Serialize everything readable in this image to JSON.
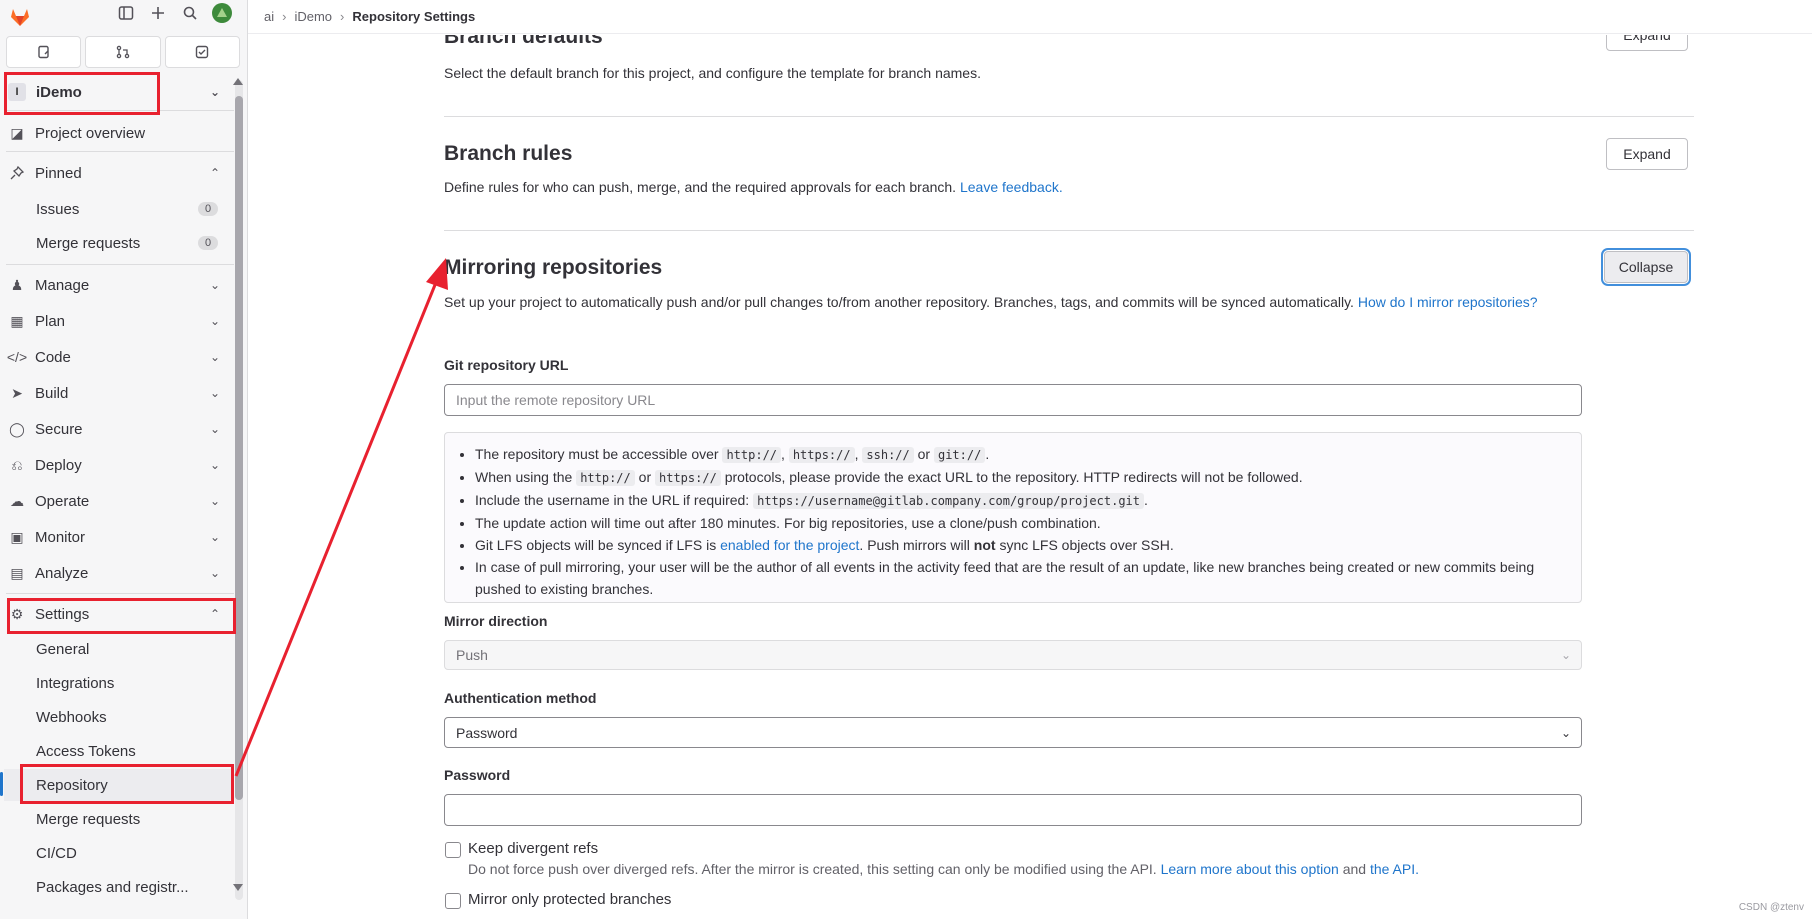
{
  "sidebar": {
    "project_initial": "I",
    "project_name": "iDemo",
    "project_overview": "Project overview",
    "pinned": "Pinned",
    "pinned_items": [
      {
        "label": "Issues",
        "count": "0"
      },
      {
        "label": "Merge requests",
        "count": "0"
      }
    ],
    "groups": [
      "Manage",
      "Plan",
      "Code",
      "Build",
      "Secure",
      "Deploy",
      "Operate",
      "Monitor",
      "Analyze"
    ],
    "settings": "Settings",
    "settings_items": [
      "General",
      "Integrations",
      "Webhooks",
      "Access Tokens",
      "Repository",
      "Merge requests",
      "CI/CD",
      "Packages and registr..."
    ],
    "active_item": "Repository"
  },
  "breadcrumb": {
    "group": "ai",
    "project": "iDemo",
    "current": "Repository Settings"
  },
  "sections": {
    "branch_defaults": {
      "title": "Branch defaults",
      "desc": "Select the default branch for this project, and configure the template for branch names.",
      "button": "Expand"
    },
    "branch_rules": {
      "title": "Branch rules",
      "desc": "Define rules for who can push, merge, and the required approvals for each branch.",
      "link": "Leave feedback.",
      "button": "Expand"
    },
    "mirroring": {
      "title": "Mirroring repositories",
      "desc": "Set up your project to automatically push and/or pull changes to/from another repository. Branches, tags, and commits will be synced automatically.",
      "link": "How do I mirror repositories?",
      "button": "Collapse"
    }
  },
  "form": {
    "git_url_label": "Git repository URL",
    "git_url_placeholder": "Input the remote repository URL",
    "info": {
      "l1_prefix": "The repository must be accessible over",
      "l1_codes": [
        "http://",
        "https://",
        "ssh://",
        "git://"
      ],
      "l1_or": "or",
      "l2_prefix": "When using the",
      "l2_code1": "http://",
      "l2_or": "or",
      "l2_code2": "https://",
      "l2_suffix": "protocols, please provide the exact URL to the repository. HTTP redirects will not be followed.",
      "l3_prefix": "Include the username in the URL if required:",
      "l3_code": "https://username@gitlab.company.com/group/project.git",
      "l4": "The update action will time out after 180 minutes. For big repositories, use a clone/push combination.",
      "l5_prefix": "Git LFS objects will be synced if LFS is",
      "l5_link": "enabled for the project",
      "l5_mid": ". Push mirrors will",
      "l5_bold": "not",
      "l5_suffix": "sync LFS objects over SSH.",
      "l6": "In case of pull mirroring, your user will be the author of all events in the activity feed that are the result of an update, like new branches being created or new commits being pushed to existing branches."
    },
    "direction_label": "Mirror direction",
    "direction_value": "Push",
    "auth_label": "Authentication method",
    "auth_value": "Password",
    "password_label": "Password",
    "password_value": "",
    "keep_divergent_label": "Keep divergent refs",
    "keep_divergent_help": "Do not force push over diverged refs. After the mirror is created, this setting can only be modified using the API.",
    "keep_divergent_link1": "Learn more about this option",
    "keep_divergent_and": "and",
    "keep_divergent_link2": "the API.",
    "protected_label": "Mirror only protected branches"
  },
  "watermark": "CSDN @ztenv",
  "colors": {
    "annotation_red": "#e8212f",
    "link_blue": "#1f75cb",
    "gitlab_orange": "#fc6d26"
  }
}
